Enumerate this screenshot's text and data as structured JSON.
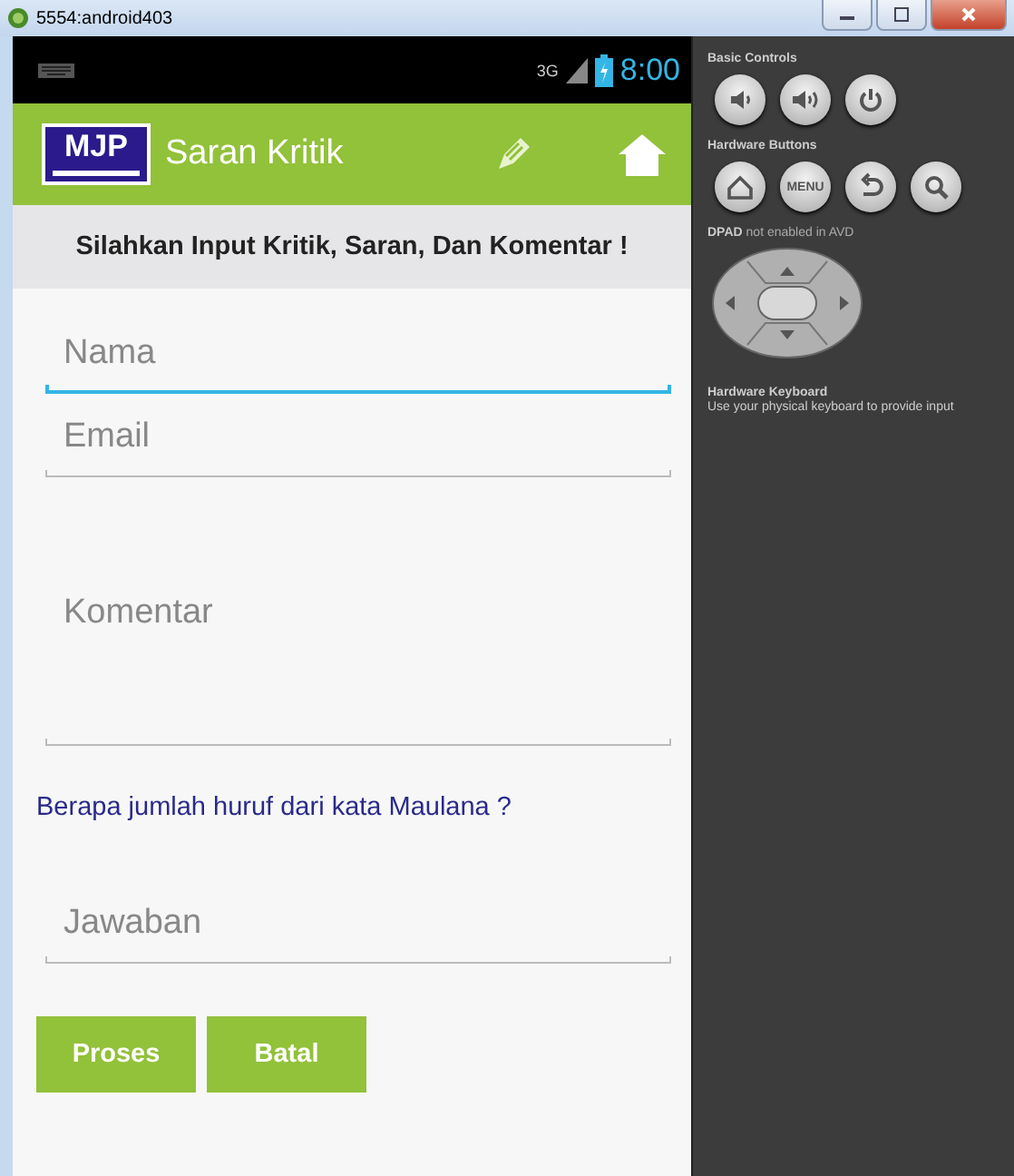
{
  "window": {
    "title": "5554:android403"
  },
  "status_bar": {
    "network": "3G",
    "time": "8:00"
  },
  "action_bar": {
    "logo": "MJP",
    "title": "Saran Kritik"
  },
  "header": "Silahkan Input Kritik, Saran, Dan Komentar !",
  "fields": [
    {
      "kind": "line",
      "placeholder": "Nama",
      "focused": true
    },
    {
      "kind": "line",
      "placeholder": "Email",
      "focused": false
    },
    {
      "kind": "multiline",
      "placeholder": "Komentar",
      "focused": false
    }
  ],
  "question": "Berapa jumlah huruf dari kata Maulana ?",
  "answer": {
    "placeholder": "Jawaban",
    "focused": false
  },
  "buttons": [
    "Proses",
    "Batal"
  ],
  "controls": {
    "basic_title": "Basic Controls",
    "basic": [
      {
        "kind": "volume-down"
      },
      {
        "kind": "volume-up"
      },
      {
        "kind": "power"
      }
    ],
    "hardware_title": "Hardware Buttons",
    "hardware": [
      {
        "kind": "home"
      },
      {
        "kind": "menu",
        "label": "MENU"
      },
      {
        "kind": "back"
      },
      {
        "kind": "search"
      }
    ],
    "dpad_title": "DPAD",
    "dpad_note": "not enabled in AVD",
    "keyboard_title": "Hardware Keyboard",
    "keyboard_note": "Use your physical keyboard to provide input"
  }
}
